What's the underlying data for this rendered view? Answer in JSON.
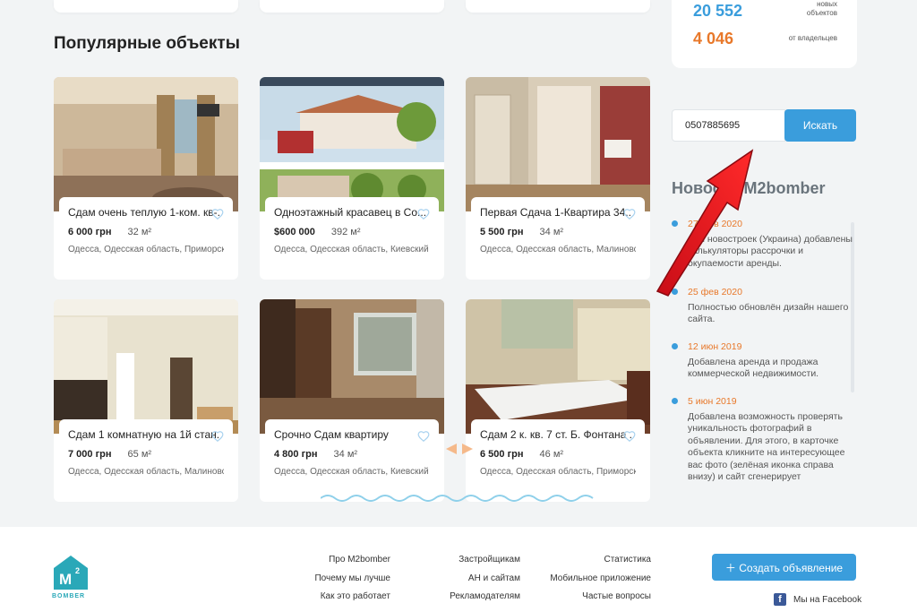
{
  "section_title": "Популярные объекты",
  "stats": [
    {
      "value": "20 552",
      "label_line1": "новых",
      "label_line2": "объектов",
      "color": "#3a9ddc"
    },
    {
      "value": "4 046",
      "label_line1": "от владельцев",
      "label_line2": "",
      "color": "#e8782a"
    }
  ],
  "search": {
    "value": "0507885695",
    "button": "Искать"
  },
  "news": {
    "title": "Новости M2bomber",
    "items": [
      {
        "date": "27 фев 2020",
        "text": "Для новостроек (Украина) добавлены калькуляторы рассрочки и окупаемости аренды."
      },
      {
        "date": "25 фев 2020",
        "text": "Полностью обновлён дизайн нашего сайта."
      },
      {
        "date": "12 июн 2019",
        "text": "Добавлена аренда и продажа коммерческой недвижимости."
      },
      {
        "date": "5 июн 2019",
        "text": "Добавлена возможность проверять уникальность фотографий в объявлении. Для этого, в карточке объекта кликните на интересующее вас фото (зелёная иконка справа внизу) и сайт сгенерирует"
      }
    ]
  },
  "listings": [
    {
      "title": "Сдам очень теплую 1-ком. кв-...",
      "price": "6 000 грн",
      "area": "32 м²",
      "address": "Одесса, Одесская область, Приморск..."
    },
    {
      "title": "Одноэтажный красавец в Со...",
      "price": "$600 000",
      "area": "392 м²",
      "address": "Одесса, Одесская область, Киевский"
    },
    {
      "title": "Первая Сдача 1-Квартира 34...",
      "price": "5 500 грн",
      "area": "34 м²",
      "address": "Одесса, Одесская область, Малиновс..."
    },
    {
      "title": "Сдам 1 комнатную на 1й стан...",
      "price": "7 000 грн",
      "area": "65 м²",
      "address": "Одесса, Одесская область, Малиновс..."
    },
    {
      "title": "Срочно Сдам квартиру",
      "price": "4 800 грн",
      "area": "34 м²",
      "address": "Одесса, Одесская область, Киевский"
    },
    {
      "title": "Сдам 2 к. кв. 7 ст. Б. Фонтана ...",
      "price": "6 500 грн",
      "area": "46 м²",
      "address": "Одесса, Одесская область, Приморск..."
    }
  ],
  "footer": {
    "logo_text": "BOMBER",
    "col1": [
      "Про M2bomber",
      "Почему мы лучше",
      "Как это работает"
    ],
    "col2": [
      "Застройщикам",
      "АН и сайтам",
      "Рекламодателям"
    ],
    "col3": [
      "Статистика",
      "Мобильное приложение",
      "Частые вопросы"
    ],
    "create_button": "Создать объявление",
    "facebook": "Мы на Facebook"
  },
  "colors": {
    "accent": "#3a9ddc",
    "orange": "#e8782a",
    "arrow": "#e0141e"
  }
}
